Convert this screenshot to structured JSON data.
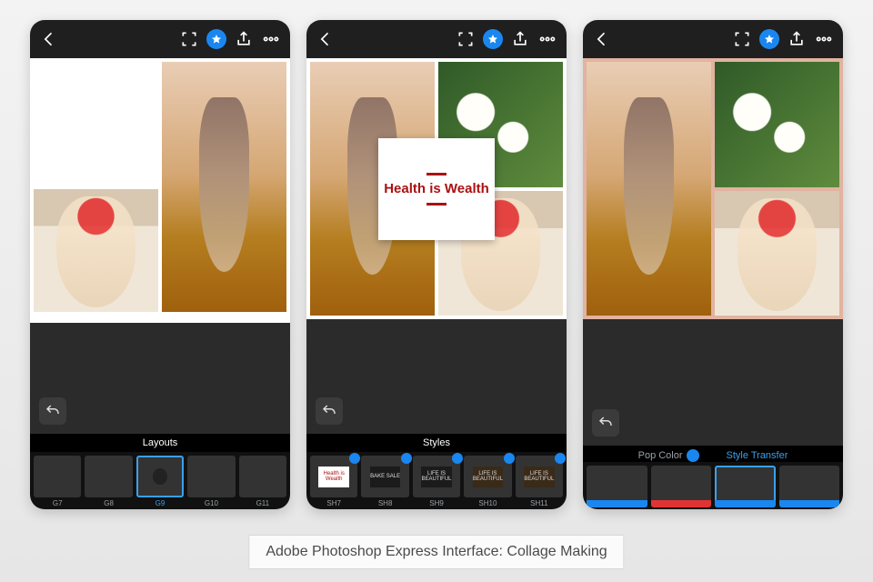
{
  "caption": "Adobe Photoshop Express Interface: Collage Making",
  "topbar": {
    "back_icon": "chevron-left",
    "scan_icon": "scan",
    "star_icon": "star",
    "share_icon": "share",
    "more_icon": "more"
  },
  "screens": [
    {
      "name": "layouts",
      "section_label": "Layouts",
      "selected_cell": 1,
      "thumbs": [
        {
          "id": "G7",
          "label": "G7",
          "selected": false
        },
        {
          "id": "G8",
          "label": "G8",
          "selected": false
        },
        {
          "id": "G9",
          "label": "G9",
          "selected": true
        },
        {
          "id": "G10",
          "label": "G10",
          "selected": false
        },
        {
          "id": "G11",
          "label": "G11",
          "selected": false
        }
      ]
    },
    {
      "name": "styles",
      "section_label": "Styles",
      "overlay_text": "Health is Wealth",
      "thumbs": [
        {
          "id": "SH7",
          "label": "SH7",
          "text": "Health is Wealth",
          "variant": "white",
          "premium": true
        },
        {
          "id": "SH8",
          "label": "SH8",
          "text": "BAKE SALE",
          "variant": "dark",
          "premium": true
        },
        {
          "id": "SH9",
          "label": "SH9",
          "text": "LIFE IS BEAUTIFUL",
          "variant": "dark",
          "premium": true
        },
        {
          "id": "SH10",
          "label": "SH10",
          "text": "LIFE IS BEAUTIFUL",
          "variant": "wide",
          "premium": true
        },
        {
          "id": "SH11",
          "label": "SH11",
          "text": "LIFE IS BEAUTIFUL",
          "variant": "wide",
          "premium": true
        }
      ]
    },
    {
      "name": "transfer",
      "tabs": [
        {
          "label": "Pop Color",
          "active": false,
          "premium": true
        },
        {
          "label": "Style Transfer",
          "active": true,
          "premium": false
        }
      ],
      "thumbs": [
        {
          "kind": "sunset",
          "accent": "#1a87f0",
          "selected": false
        },
        {
          "kind": "truck",
          "accent": "#e03434",
          "selected": false
        },
        {
          "kind": "dusk",
          "accent": "#1a87f0",
          "selected": true
        },
        {
          "kind": "coast",
          "accent": "#1a87f0",
          "selected": false
        }
      ]
    }
  ]
}
